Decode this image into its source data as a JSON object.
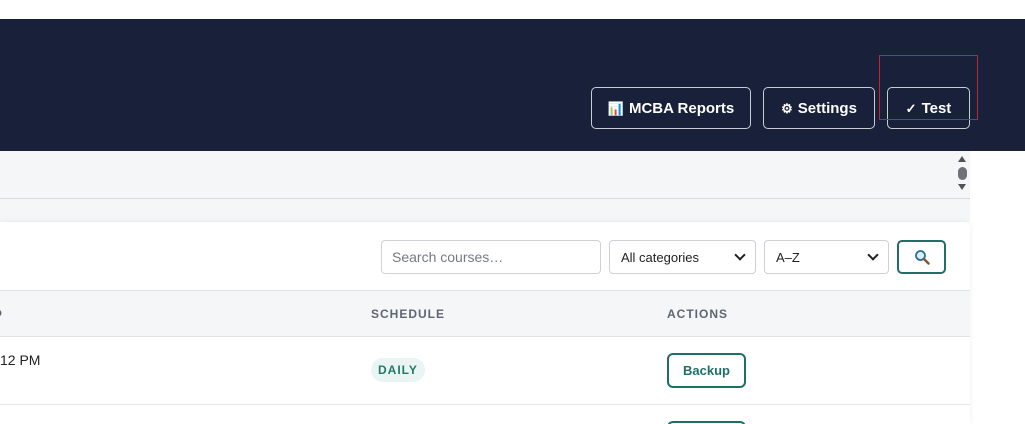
{
  "header": {
    "buttons": [
      {
        "icon": "bar-chart-icon",
        "glyph": "📊",
        "label": "MCBA Reports"
      },
      {
        "icon": "gear-icon",
        "glyph": "⚙",
        "label": "Settings"
      },
      {
        "icon": "check-icon",
        "glyph": "✓",
        "label": "Test"
      }
    ]
  },
  "toolbar": {
    "search_placeholder": "Search courses…",
    "category_filter": {
      "selected": "All categories"
    },
    "sort": {
      "selected": "A–Z"
    },
    "search_button_icon": "magnifier-icon"
  },
  "table": {
    "columns": [
      "SCHEDULE",
      "ACTIONS"
    ],
    "rows": [
      {
        "time_partial": "12 PM",
        "schedule": "DAILY",
        "action": "Backup"
      }
    ]
  },
  "colors": {
    "header_bg": "#19203a",
    "accent": "#1f6f66",
    "focus_outline": "#c0242c"
  }
}
